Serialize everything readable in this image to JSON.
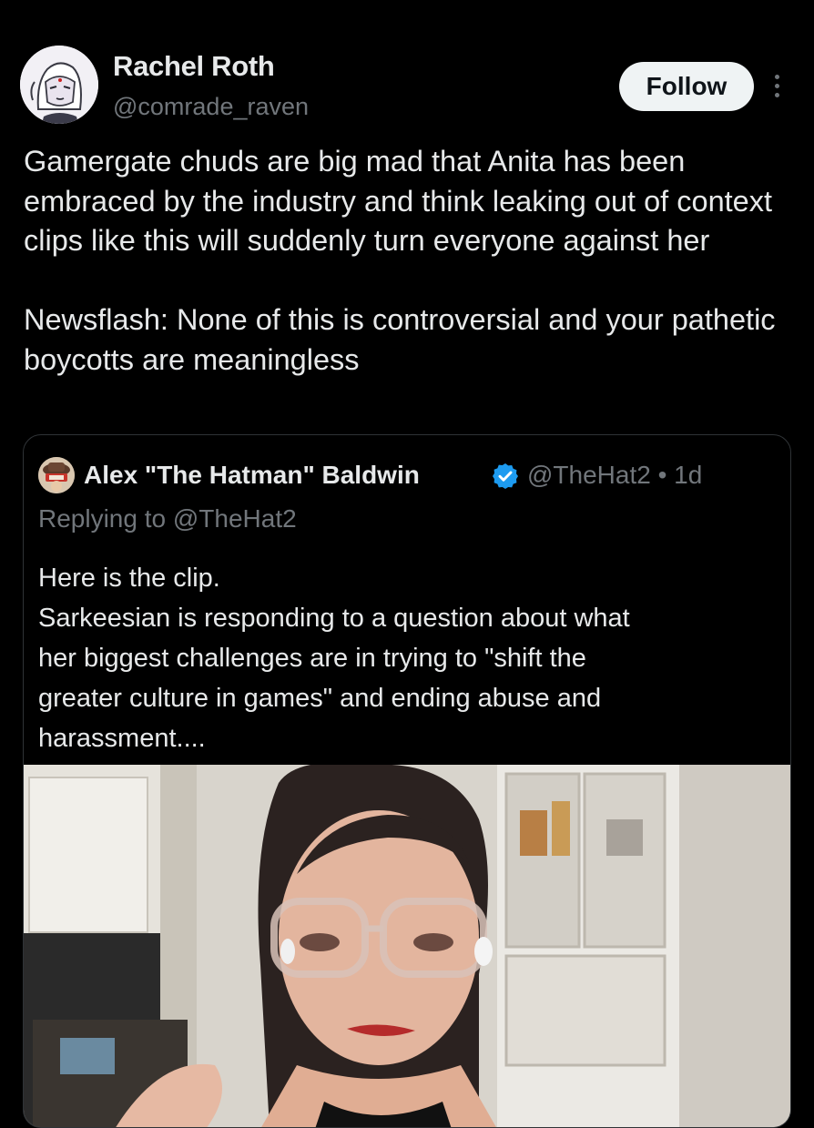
{
  "author": {
    "display_name": "Rachel Roth",
    "handle": "@comrade_raven",
    "avatar_icon": "cartoon-character-avatar"
  },
  "actions": {
    "follow_label": "Follow",
    "more_icon": "vertical-ellipsis-icon"
  },
  "tweet": {
    "paragraph_1": "Gamergate chuds are big mad that Anita has been embraced by the industry and think leaking out of context clips like this will suddenly turn everyone against her",
    "paragraph_2": "Newsflash: None of this is controversial and your pathetic boycotts are meaningless"
  },
  "quote": {
    "display_name": "Alex \"The Hatman\" Baldwin",
    "handle_time": "@TheHat2 • 1d",
    "replying_to": "Replying to @TheHat2",
    "lines": [
      "Here is the clip.",
      "Sarkeesian is responding to a question about what",
      "her biggest challenges are in trying to \"shift the",
      "greater culture in games\" and ending abuse and",
      "harassment...."
    ],
    "verified_icon": "verified-badge-icon",
    "media": "video-still-woman-with-glasses"
  },
  "colors": {
    "background": "#000000",
    "text_primary": "#e7e9ea",
    "text_secondary": "#71767b",
    "verified_blue": "#1d9bf0",
    "border": "#2f3336"
  }
}
